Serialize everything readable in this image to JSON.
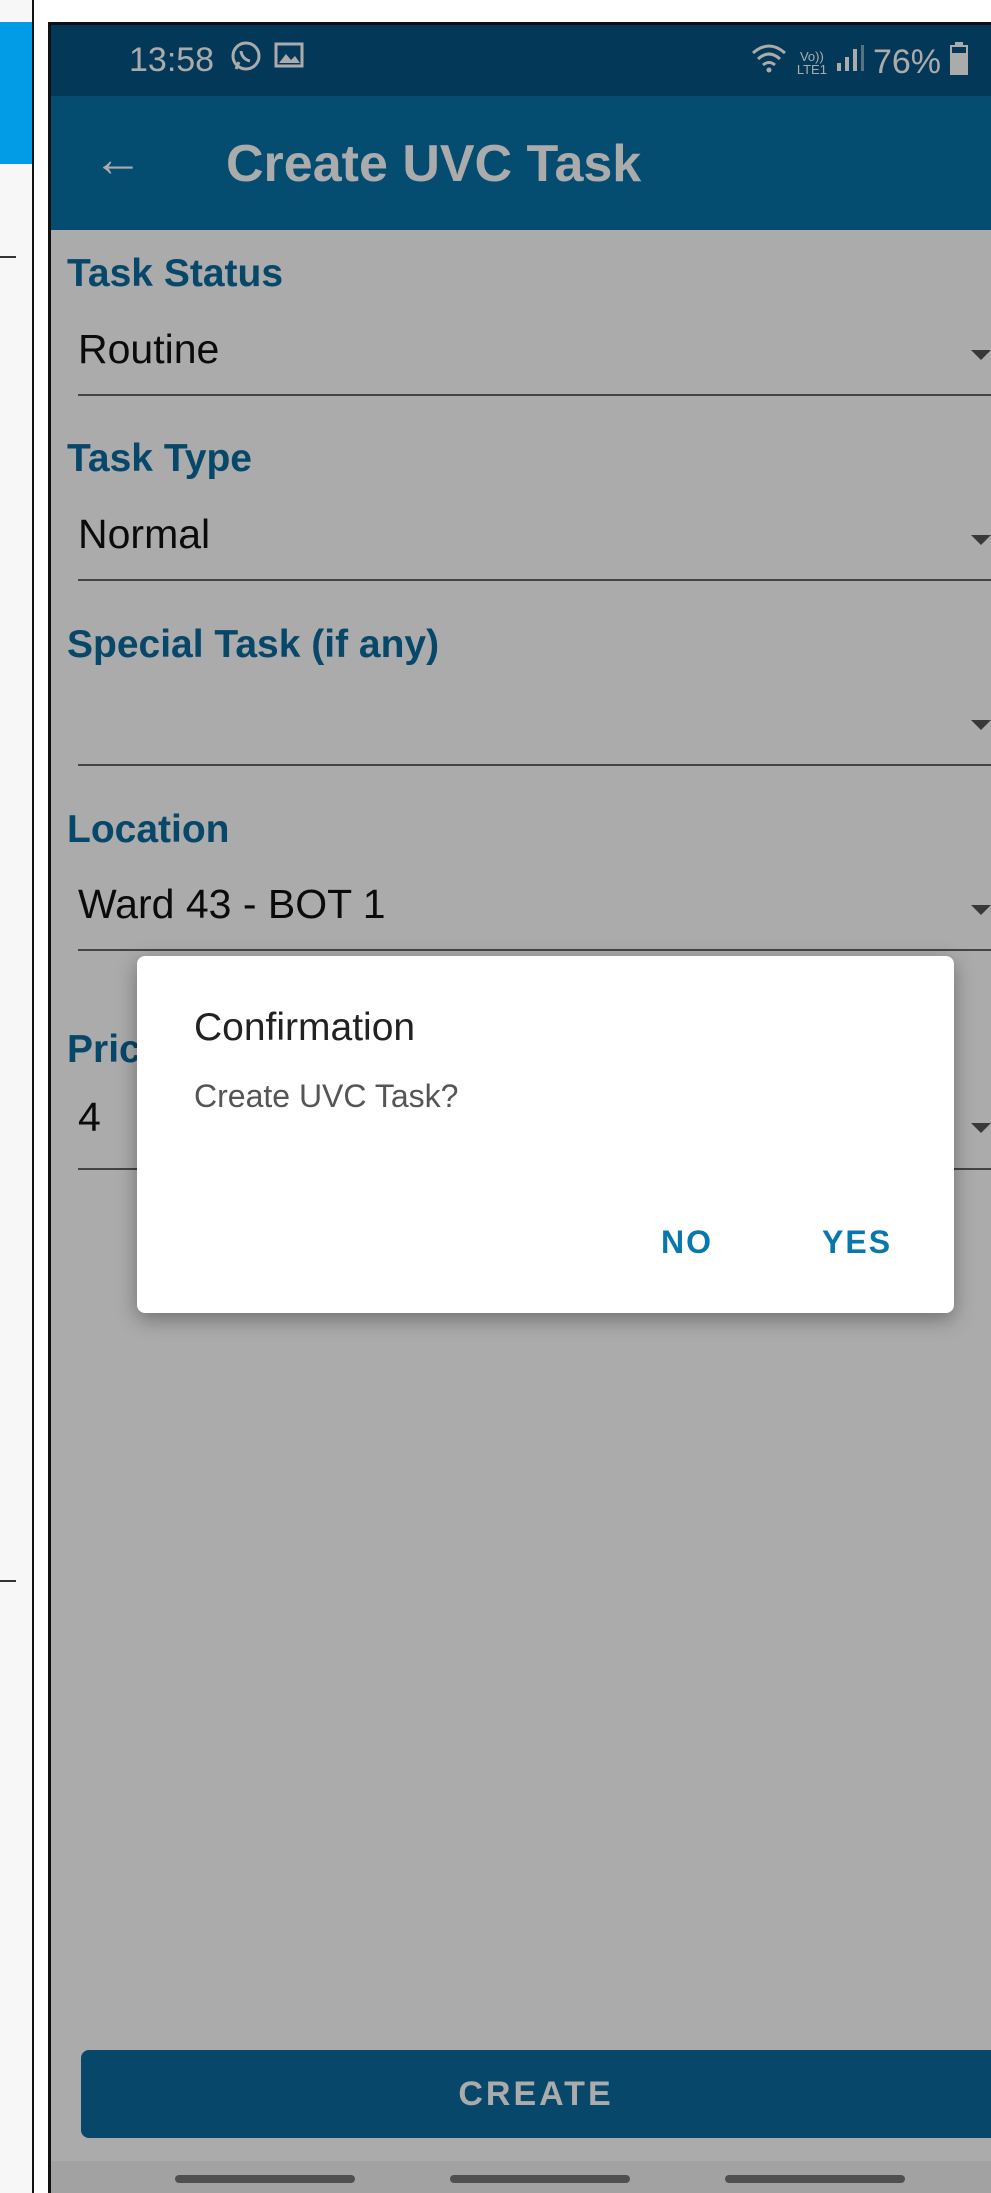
{
  "status_bar": {
    "time": "13:58",
    "left_icons": [
      "whatsapp-icon",
      "gallery-icon"
    ],
    "right_icons": [
      "wifi-icon",
      "volte-icon",
      "signal-icon"
    ],
    "volte_text": "Vo))\nLTE1",
    "battery_percent": "76%",
    "battery_level": 0.76
  },
  "app_bar": {
    "back_glyph": "←",
    "title": "Create UVC Task",
    "color": "#0672a8"
  },
  "form": {
    "task_status": {
      "label": "Task Status",
      "value": "Routine"
    },
    "task_type": {
      "label": "Task Type",
      "value": "Normal"
    },
    "special_task": {
      "label": "Special Task (if any)",
      "value": ""
    },
    "location": {
      "label": "Location",
      "value": "Ward 43 - BOT 1"
    },
    "priority": {
      "label": "Pric",
      "value": "4"
    }
  },
  "create_button": {
    "label": "CREATE"
  },
  "dialog": {
    "title": "Confirmation",
    "message": "Create UVC Task?",
    "no_label": "NO",
    "yes_label": "YES"
  },
  "colors": {
    "accent": "#0b6a9f",
    "status_bar": "#055483",
    "dialog_button": "#0877ad"
  }
}
